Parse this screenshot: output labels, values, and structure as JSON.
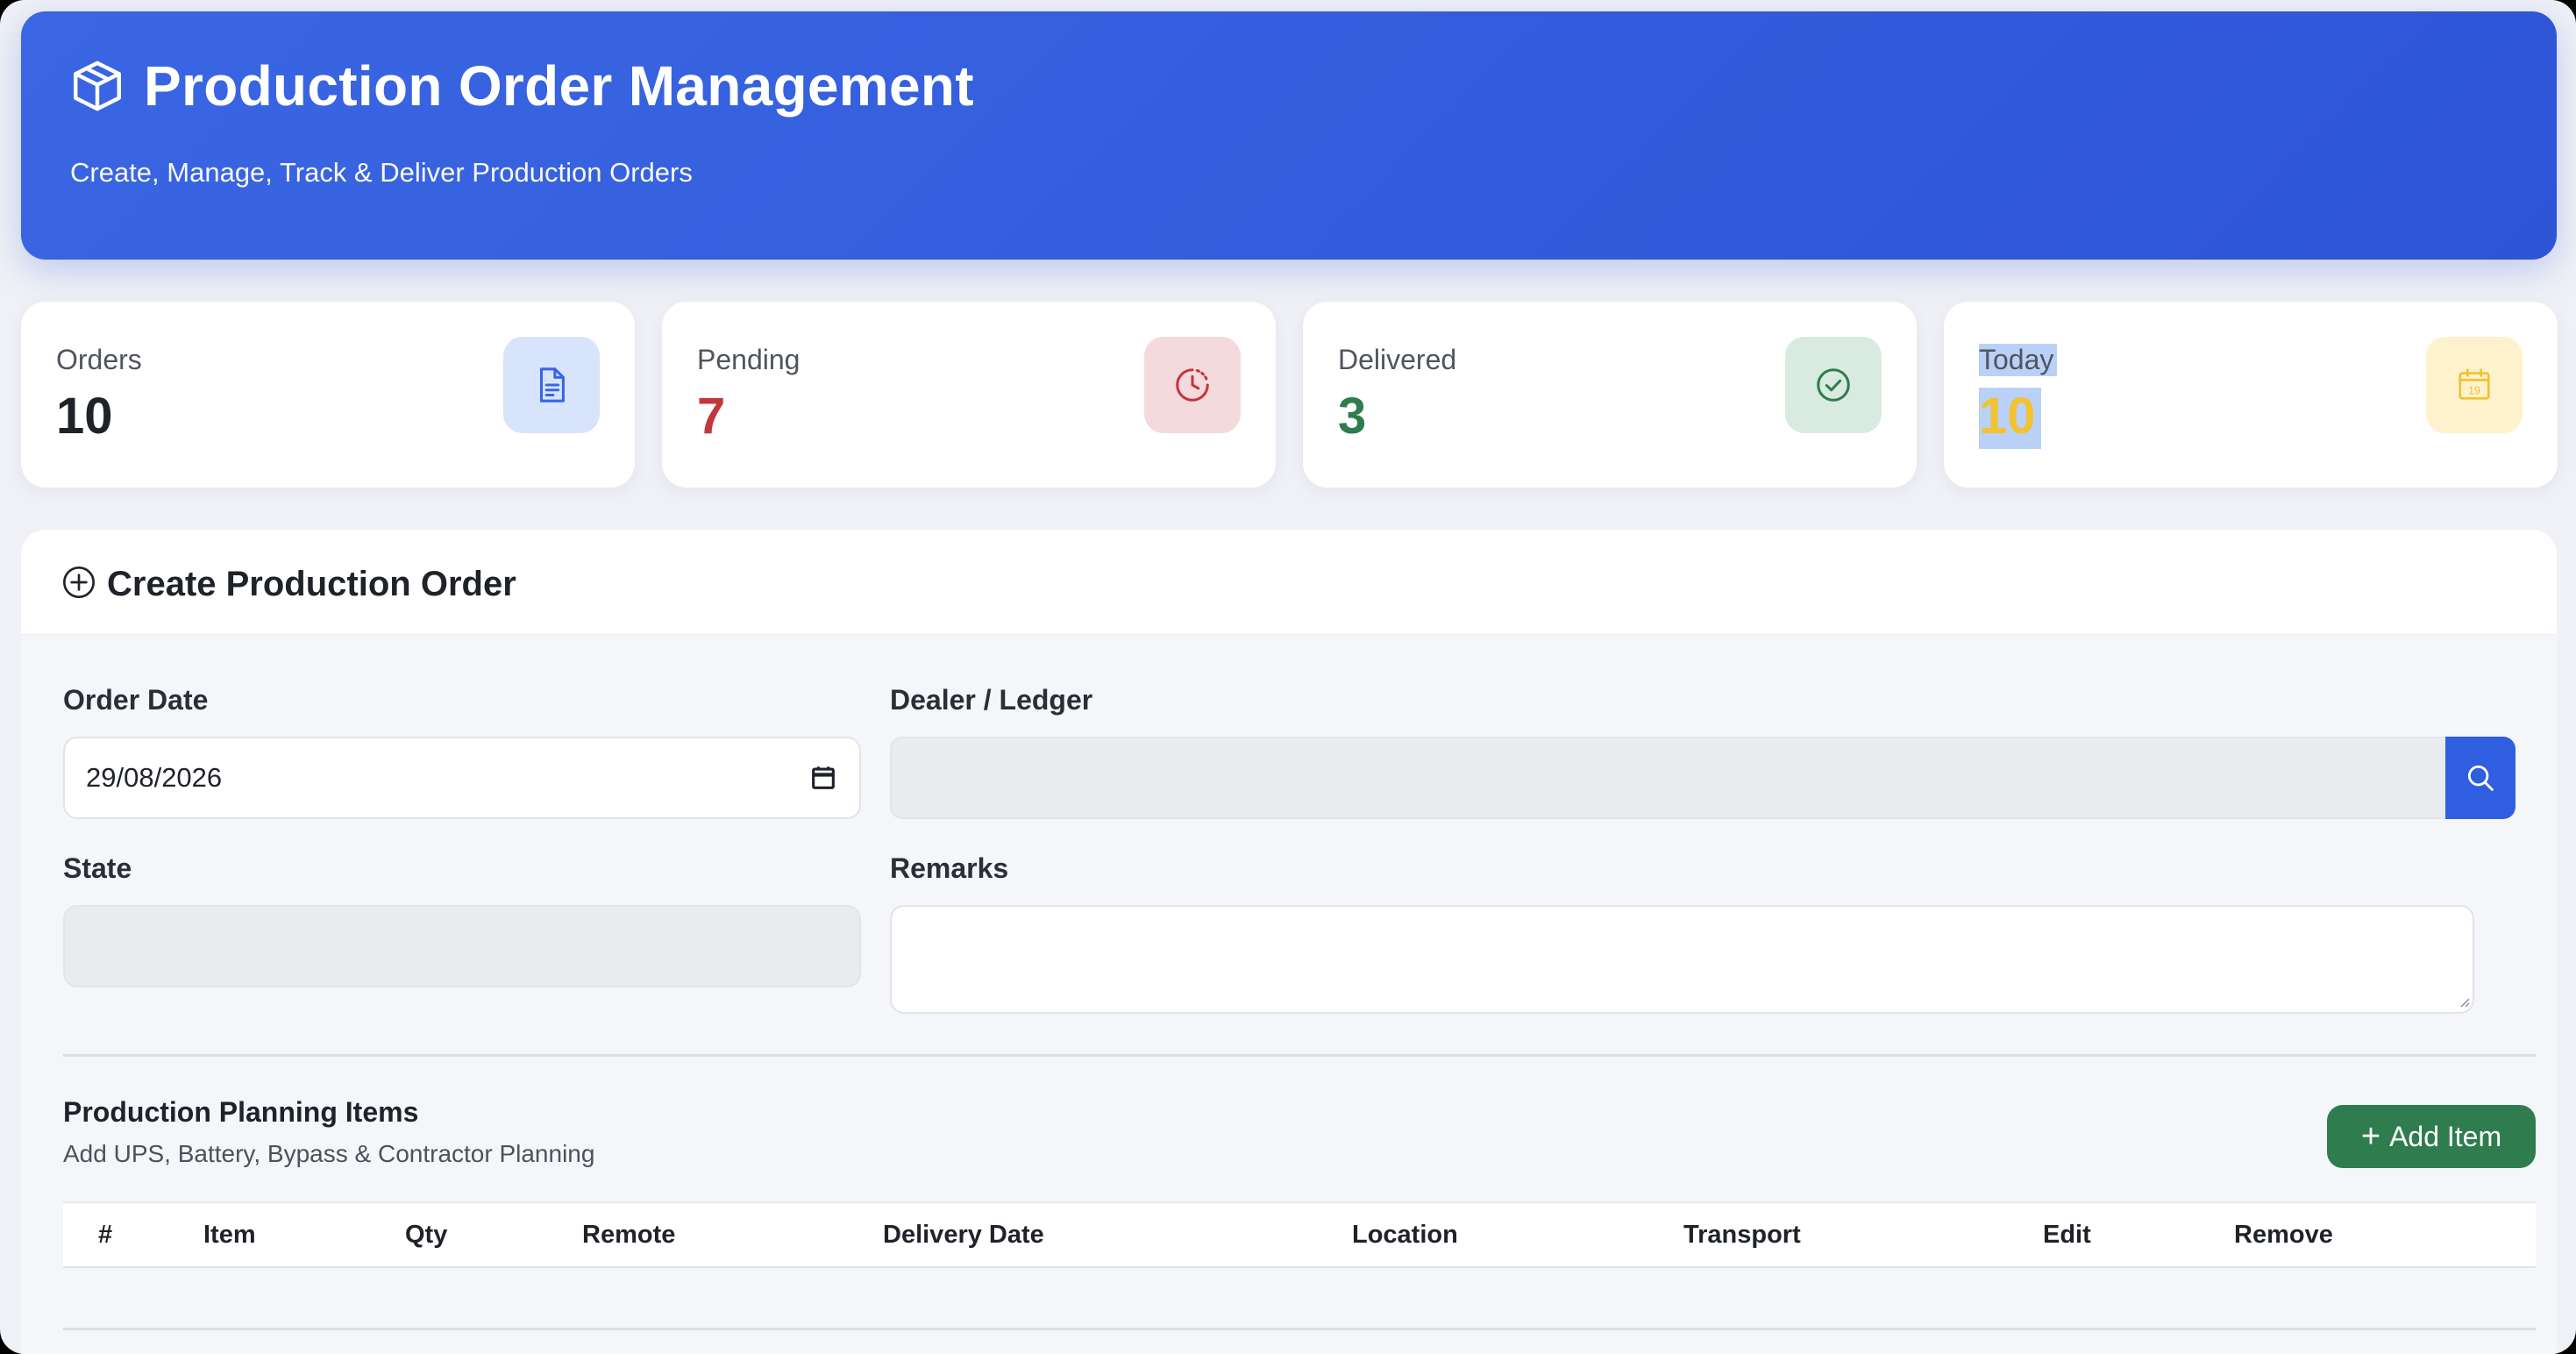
{
  "header": {
    "title": "Production Order Management",
    "subtitle": "Create, Manage, Track & Deliver Production Orders",
    "icon": "box-icon"
  },
  "stats": [
    {
      "label": "Orders",
      "value": "10",
      "icon": "document-icon",
      "value_color": "#1f2329",
      "icon_bg": "#d7e4fb",
      "icon_color": "#3a66e3"
    },
    {
      "label": "Pending",
      "value": "7",
      "icon": "clock-icon",
      "value_color": "#c2373c",
      "icon_bg": "#f5dadd",
      "icon_color": "#c2373c"
    },
    {
      "label": "Delivered",
      "value": "3",
      "icon": "check-circle-icon",
      "value_color": "#2f7d4f",
      "icon_bg": "#d9ebe0",
      "icon_color": "#2f7d4f"
    },
    {
      "label": "Today",
      "value": "10",
      "icon": "calendar-icon",
      "value_color": "#f2c230",
      "icon_bg": "#fdf2cc",
      "icon_color": "#f2c230",
      "icon_text": "19"
    }
  ],
  "create_order": {
    "title": "Create Production Order",
    "order_date": {
      "label": "Order Date",
      "value": "29/08/2026"
    },
    "dealer": {
      "label": "Dealer / Ledger",
      "value": ""
    },
    "state": {
      "label": "State",
      "value": ""
    },
    "remarks": {
      "label": "Remarks",
      "value": ""
    }
  },
  "items": {
    "title": "Production Planning Items",
    "subtitle": "Add UPS, Battery, Bypass & Contractor Planning",
    "add_button": "Add Item",
    "columns": [
      "#",
      "Item",
      "Qty",
      "Remote",
      "Delivery Date",
      "Location",
      "Transport",
      "Edit",
      "Remove"
    ]
  },
  "colors": {
    "primary": "#2f5ee0",
    "success": "#2f7d4f",
    "danger": "#c2373c",
    "warning": "#f2c230"
  }
}
